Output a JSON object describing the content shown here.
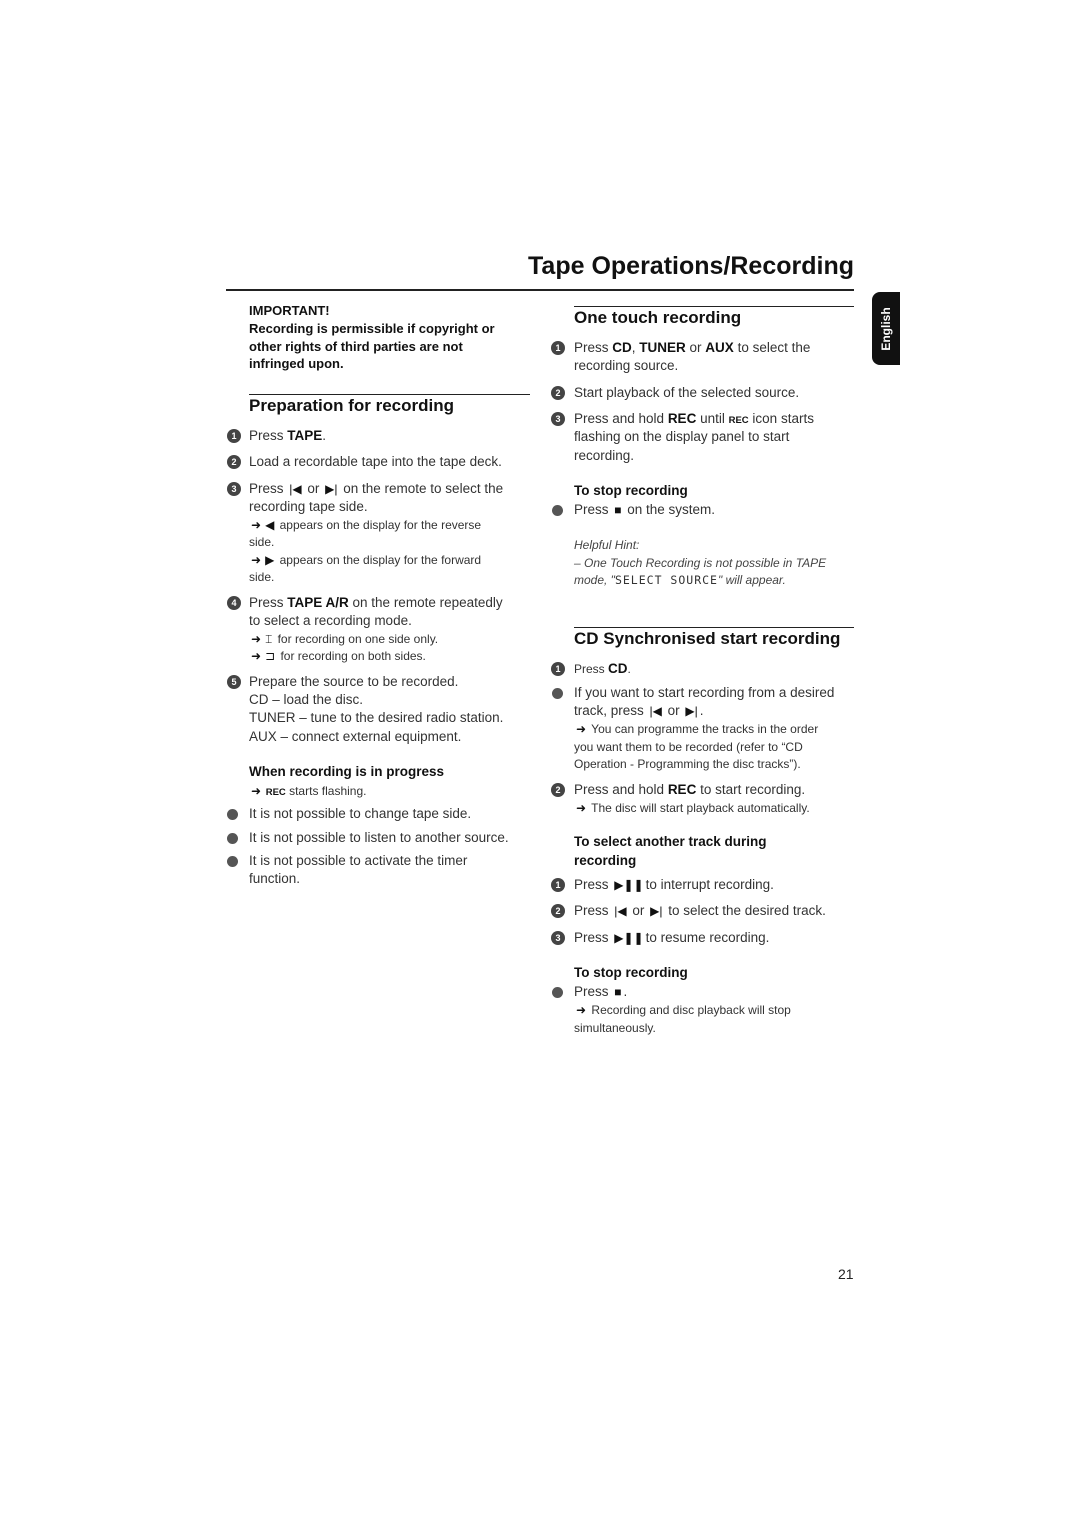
{
  "header": {
    "title": "Tape Operations/Recording",
    "language_tab": "English"
  },
  "page_number": "21",
  "left": {
    "important_label": "IMPORTANT!",
    "important_text": [
      "Recording is permissible if copyright or",
      "other rights of third parties are not",
      "infringed upon."
    ],
    "prep": {
      "heading": "Preparation for recording",
      "steps": [
        "1",
        "2",
        "3",
        "4",
        "5"
      ],
      "lines": [
        [
          [
            "Press ",
            ""
          ],
          [
            "TAPE",
            "b"
          ],
          [
            ".",
            ""
          ]
        ],
        [
          [
            "Load a recordable tape into the tape deck.",
            ""
          ]
        ],
        [
          [
            "Press ",
            ""
          ],
          [
            "prev-icon",
            "i"
          ],
          [
            " or ",
            ""
          ],
          [
            "next-icon",
            "i"
          ],
          [
            " on the remote to select the",
            ""
          ]
        ],
        [
          [
            "recording tape side.",
            ""
          ]
        ],
        [
          [
            "arrow-icon",
            "i"
          ],
          [
            "reverse-icon",
            "i"
          ],
          [
            " appears on the display for the reverse",
            "sm"
          ]
        ],
        [
          [
            "side.",
            "sm"
          ]
        ],
        [
          [
            "arrow-icon",
            "i"
          ],
          [
            "forward-icon",
            "i"
          ],
          [
            " appears on the display for the forward",
            "sm"
          ]
        ],
        [
          [
            "side.",
            "sm"
          ]
        ],
        [
          [
            "Press ",
            ""
          ],
          [
            "TAPE A/R",
            "b"
          ],
          [
            " on the remote repeatedly",
            ""
          ]
        ],
        [
          [
            "to select a recording mode.",
            ""
          ]
        ],
        [
          [
            "arrow-icon",
            "i"
          ],
          [
            "one-side-icon",
            "i"
          ],
          [
            " for recording on one side only.",
            "sm"
          ]
        ],
        [
          [
            "arrow-icon",
            "i"
          ],
          [
            "both-sides-icon",
            "i"
          ],
          [
            " for recording on both sides.",
            "sm"
          ]
        ],
        [
          [
            "Prepare the source to be recorded.",
            ""
          ]
        ],
        [
          [
            "CD",
            "n"
          ],
          [
            " – load the disc.",
            ""
          ]
        ],
        [
          [
            "TUNER",
            "n"
          ],
          [
            " – tune to the desired radio station.",
            ""
          ]
        ],
        [
          [
            "AUX",
            "n"
          ],
          [
            " – connect external equipment.",
            ""
          ]
        ]
      ]
    },
    "progress": {
      "heading": "When recording is in progress",
      "lines": [
        [
          [
            "arrow-icon",
            "i"
          ],
          [
            " REC",
            "rec"
          ],
          [
            " starts flashing.",
            "sm"
          ]
        ],
        [
          [
            "It is not possible to change tape side.",
            ""
          ]
        ],
        [
          [
            "It is not possible to listen to another source.",
            ""
          ]
        ],
        [
          [
            "It is not possible to activate the timer",
            ""
          ]
        ],
        [
          [
            "function.",
            ""
          ]
        ]
      ]
    }
  },
  "right": {
    "one_touch": {
      "heading": "One touch recording",
      "lines": [
        [
          [
            "Press ",
            ""
          ],
          [
            "CD",
            "b"
          ],
          [
            ", ",
            ""
          ],
          [
            "TUNER",
            "b"
          ],
          [
            " or ",
            ""
          ],
          [
            "AUX",
            "b"
          ],
          [
            " to select the",
            ""
          ]
        ],
        [
          [
            "recording source.",
            ""
          ]
        ],
        [
          [
            "Start playback of the selected source.",
            ""
          ]
        ],
        [
          [
            "Press and hold ",
            ""
          ],
          [
            "REC",
            "b"
          ],
          [
            " until ",
            ""
          ],
          [
            "REC",
            "rec"
          ],
          [
            " icon starts",
            ""
          ]
        ],
        [
          [
            "flashing on the display panel to start",
            ""
          ]
        ],
        [
          [
            "recording.",
            ""
          ]
        ]
      ],
      "stop_heading": "To stop recording",
      "stop_lines": [
        [
          [
            "Press ",
            ""
          ],
          [
            "stop-icon",
            "i"
          ],
          [
            " on the system.",
            ""
          ]
        ]
      ],
      "hint_label": "Helpful Hint:",
      "hint_lines": [
        [
          [
            "– One Touch Recording is not possible in TAPE",
            "it"
          ]
        ],
        [
          [
            "mode, \"",
            "it"
          ],
          [
            "SELECT SOURCE",
            "lcd"
          ],
          [
            "\" will appear.",
            "it"
          ]
        ]
      ]
    },
    "cd_sync": {
      "heading": "CD Synchronised start recording",
      "lines": [
        [
          [
            "Press ",
            "sm"
          ],
          [
            "CD",
            "b"
          ],
          [
            ".",
            "sm"
          ]
        ],
        [
          [
            "If you want to start recording from a desired",
            ""
          ]
        ],
        [
          [
            "track, press ",
            ""
          ],
          [
            "prev-icon",
            "i"
          ],
          [
            " or ",
            ""
          ],
          [
            "next-icon",
            "i"
          ],
          [
            ".",
            ""
          ]
        ],
        [
          [
            "arrow-icon",
            "i"
          ],
          [
            " You can programme the tracks in the order",
            "sm"
          ]
        ],
        [
          [
            "you want them to be recorded (refer to “CD",
            "sm"
          ]
        ],
        [
          [
            "Operation - Programming the disc tracks”).",
            "sm"
          ]
        ],
        [
          [
            "Press and hold ",
            ""
          ],
          [
            "REC",
            "b"
          ],
          [
            " to start recording.",
            ""
          ]
        ],
        [
          [
            "arrow-icon",
            "i"
          ],
          [
            " The disc will start playback automatically.",
            "sm"
          ]
        ]
      ],
      "select_heading": [
        "To select another track during",
        "recording"
      ],
      "select_lines": [
        [
          [
            "Press ",
            ""
          ],
          [
            "play-pause-icon",
            "i"
          ],
          [
            "to interrupt recording.",
            ""
          ]
        ],
        [
          [
            "Press ",
            ""
          ],
          [
            "prev-icon",
            "i"
          ],
          [
            " or ",
            ""
          ],
          [
            "next-icon",
            "i"
          ],
          [
            " to select the desired track.",
            ""
          ]
        ],
        [
          [
            "Press ",
            ""
          ],
          [
            "play-pause-icon",
            "i"
          ],
          [
            "to resume recording.",
            ""
          ]
        ]
      ],
      "stop_heading": "To stop recording",
      "stop_lines": [
        [
          [
            "Press ",
            ""
          ],
          [
            "stop-icon",
            "i"
          ],
          [
            ".",
            ""
          ]
        ],
        [
          [
            "arrow-icon",
            "i"
          ],
          [
            " Recording and disc playback will stop",
            "sm"
          ]
        ],
        [
          [
            "simultaneously.",
            "sm"
          ]
        ]
      ]
    }
  }
}
